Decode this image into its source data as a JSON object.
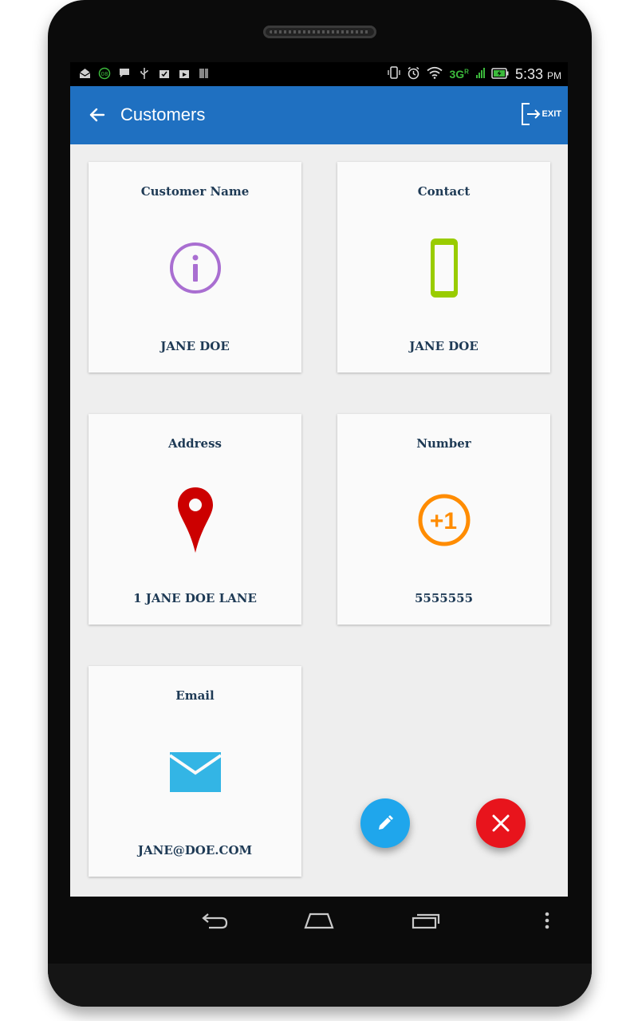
{
  "status_bar": {
    "network": "3G",
    "network_superscript": "R",
    "time": "5:33",
    "ampm": "PM",
    "notification_badge": "08"
  },
  "app_bar": {
    "title": "Customers",
    "exit_label": "EXIT"
  },
  "cards": [
    {
      "title": "Customer Name",
      "value": "JANE DOE",
      "icon": "info-icon",
      "color": "#a96ed1"
    },
    {
      "title": "Contact",
      "value": "JANE DOE",
      "icon": "smartphone-icon",
      "color": "#99cc00"
    },
    {
      "title": "Address",
      "value": "1 JANE DOE LANE",
      "icon": "map-pin-icon",
      "color": "#cc0000"
    },
    {
      "title": "Number",
      "value": "5555555",
      "icon": "plus-one-icon",
      "color": "#ff8c00",
      "icon_text": "+1"
    },
    {
      "title": "Email",
      "value": "JANE@DOE.COM",
      "icon": "envelope-icon",
      "color": "#33b5e5"
    }
  ],
  "colors": {
    "app_bar": "#1f70c1",
    "edit_fab": "#1fa6ec",
    "close_fab": "#e8141c",
    "card_text": "#1e3a55"
  }
}
